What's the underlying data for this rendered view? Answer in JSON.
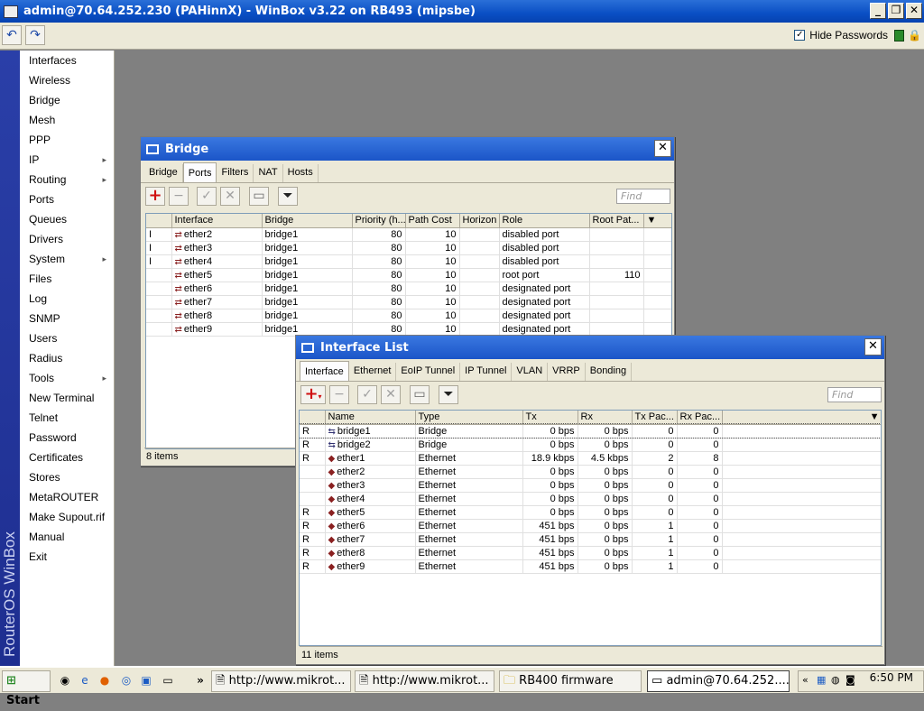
{
  "app": {
    "title": "admin@70.64.252.230 (PAHinnX) - WinBox v3.22 on RB493 (mipsbe)",
    "hide_passwords": "Hide Passwords",
    "banner": "RouterOS WinBox"
  },
  "menu": [
    {
      "label": "Interfaces",
      "sub": false
    },
    {
      "label": "Wireless",
      "sub": false
    },
    {
      "label": "Bridge",
      "sub": false
    },
    {
      "label": "Mesh",
      "sub": false
    },
    {
      "label": "PPP",
      "sub": false
    },
    {
      "label": "IP",
      "sub": true
    },
    {
      "label": "Routing",
      "sub": true
    },
    {
      "label": "Ports",
      "sub": false
    },
    {
      "label": "Queues",
      "sub": false
    },
    {
      "label": "Drivers",
      "sub": false
    },
    {
      "label": "System",
      "sub": true
    },
    {
      "label": "Files",
      "sub": false
    },
    {
      "label": "Log",
      "sub": false
    },
    {
      "label": "SNMP",
      "sub": false
    },
    {
      "label": "Users",
      "sub": false
    },
    {
      "label": "Radius",
      "sub": false
    },
    {
      "label": "Tools",
      "sub": true
    },
    {
      "label": "New Terminal",
      "sub": false
    },
    {
      "label": "Telnet",
      "sub": false
    },
    {
      "label": "Password",
      "sub": false
    },
    {
      "label": "Certificates",
      "sub": false
    },
    {
      "label": "Stores",
      "sub": false
    },
    {
      "label": "MetaROUTER",
      "sub": false
    },
    {
      "label": "Make Supout.rif",
      "sub": false
    },
    {
      "label": "Manual",
      "sub": false
    },
    {
      "label": "Exit",
      "sub": false
    }
  ],
  "bridge": {
    "title": "Bridge",
    "tabs": [
      "Bridge",
      "Ports",
      "Filters",
      "NAT",
      "Hosts"
    ],
    "active_tab": "Ports",
    "find": "Find",
    "columns": [
      "Interface",
      "Bridge",
      "Priority (h...",
      "Path Cost",
      "Horizon",
      "Role",
      "Root Pat..."
    ],
    "rows": [
      {
        "flag": "I",
        "iface": "ether2",
        "bridge": "bridge1",
        "priority": "80",
        "cost": "10",
        "horizon": "",
        "role": "disabled port",
        "root": ""
      },
      {
        "flag": "I",
        "iface": "ether3",
        "bridge": "bridge1",
        "priority": "80",
        "cost": "10",
        "horizon": "",
        "role": "disabled port",
        "root": ""
      },
      {
        "flag": "I",
        "iface": "ether4",
        "bridge": "bridge1",
        "priority": "80",
        "cost": "10",
        "horizon": "",
        "role": "disabled port",
        "root": ""
      },
      {
        "flag": "",
        "iface": "ether5",
        "bridge": "bridge1",
        "priority": "80",
        "cost": "10",
        "horizon": "",
        "role": "root port",
        "root": "110"
      },
      {
        "flag": "",
        "iface": "ether6",
        "bridge": "bridge1",
        "priority": "80",
        "cost": "10",
        "horizon": "",
        "role": "designated port",
        "root": ""
      },
      {
        "flag": "",
        "iface": "ether7",
        "bridge": "bridge1",
        "priority": "80",
        "cost": "10",
        "horizon": "",
        "role": "designated port",
        "root": ""
      },
      {
        "flag": "",
        "iface": "ether8",
        "bridge": "bridge1",
        "priority": "80",
        "cost": "10",
        "horizon": "",
        "role": "designated port",
        "root": ""
      },
      {
        "flag": "",
        "iface": "ether9",
        "bridge": "bridge1",
        "priority": "80",
        "cost": "10",
        "horizon": "",
        "role": "designated port",
        "root": ""
      }
    ],
    "status": "8 items"
  },
  "iflist": {
    "title": "Interface List",
    "tabs": [
      "Interface",
      "Ethernet",
      "EoIP Tunnel",
      "IP Tunnel",
      "VLAN",
      "VRRP",
      "Bonding"
    ],
    "active_tab": "Interface",
    "find": "Find",
    "columns": [
      "Name",
      "Type",
      "Tx",
      "Rx",
      "Tx Pac...",
      "Rx Pac..."
    ],
    "rows": [
      {
        "flag": "R",
        "name": "bridge1",
        "kind": "bridge",
        "type": "Bridge",
        "tx": "0 bps",
        "rx": "0 bps",
        "txp": "0",
        "rxp": "0"
      },
      {
        "flag": "R",
        "name": "bridge2",
        "kind": "bridge",
        "type": "Bridge",
        "tx": "0 bps",
        "rx": "0 bps",
        "txp": "0",
        "rxp": "0"
      },
      {
        "flag": "R",
        "name": "ether1",
        "kind": "ether",
        "type": "Ethernet",
        "tx": "18.9 kbps",
        "rx": "4.5 kbps",
        "txp": "2",
        "rxp": "8"
      },
      {
        "flag": "",
        "name": "ether2",
        "kind": "ether",
        "type": "Ethernet",
        "tx": "0 bps",
        "rx": "0 bps",
        "txp": "0",
        "rxp": "0"
      },
      {
        "flag": "",
        "name": "ether3",
        "kind": "ether",
        "type": "Ethernet",
        "tx": "0 bps",
        "rx": "0 bps",
        "txp": "0",
        "rxp": "0"
      },
      {
        "flag": "",
        "name": "ether4",
        "kind": "ether",
        "type": "Ethernet",
        "tx": "0 bps",
        "rx": "0 bps",
        "txp": "0",
        "rxp": "0"
      },
      {
        "flag": "R",
        "name": "ether5",
        "kind": "ether",
        "type": "Ethernet",
        "tx": "0 bps",
        "rx": "0 bps",
        "txp": "0",
        "rxp": "0"
      },
      {
        "flag": "R",
        "name": "ether6",
        "kind": "ether",
        "type": "Ethernet",
        "tx": "451 bps",
        "rx": "0 bps",
        "txp": "1",
        "rxp": "0"
      },
      {
        "flag": "R",
        "name": "ether7",
        "kind": "ether",
        "type": "Ethernet",
        "tx": "451 bps",
        "rx": "0 bps",
        "txp": "1",
        "rxp": "0"
      },
      {
        "flag": "R",
        "name": "ether8",
        "kind": "ether",
        "type": "Ethernet",
        "tx": "451 bps",
        "rx": "0 bps",
        "txp": "1",
        "rxp": "0"
      },
      {
        "flag": "R",
        "name": "ether9",
        "kind": "ether",
        "type": "Ethernet",
        "tx": "451 bps",
        "rx": "0 bps",
        "txp": "1",
        "rxp": "0"
      }
    ],
    "status": "11 items"
  },
  "taskbar": {
    "start": "Start",
    "tasks": [
      "http://www.mikrot...",
      "http://www.mikrot...",
      "RB400 firmware",
      "admin@70.64.252...."
    ],
    "clock": "6:50 PM"
  }
}
